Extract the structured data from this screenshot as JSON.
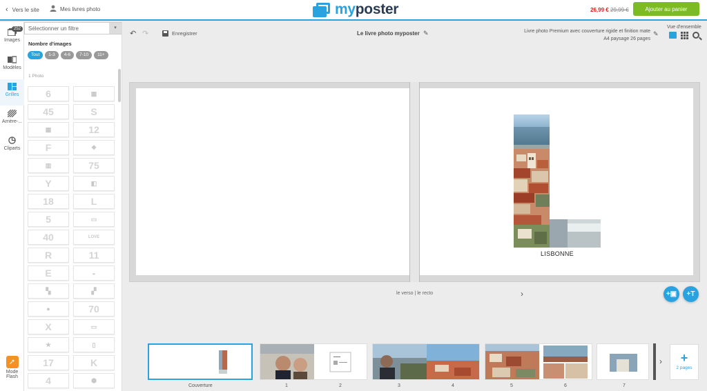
{
  "topbar": {
    "back_label": "Vers le site",
    "mybooks_label": "Mes livres photo",
    "logo_text_blue": "my",
    "logo_text_dark": "poster",
    "price_new": "26,99 €",
    "price_old": "29,99 €",
    "add_to_cart": "Ajouter au panier"
  },
  "rail": {
    "images_label": "Images",
    "images_badge": "252",
    "templates_label": "Modèles",
    "grids_label": "Grilles",
    "backgrounds_label": "Arrière-...",
    "cliparts_label": "Cliparts",
    "flash_label_1": "Mode",
    "flash_label_2": "Flash"
  },
  "panel": {
    "filter_placeholder": "Sélectionner un filtre",
    "count_title": "Nombre d'images",
    "chips": [
      "Tout",
      "1-3",
      "4-6",
      "7-10",
      "11+"
    ],
    "active_chip": "Tout",
    "section_label": "1 Photo",
    "tiles": [
      "6",
      "grid-a",
      "45",
      "S",
      "grid-b",
      "12",
      "F",
      "diamond",
      "stack",
      "75",
      "Y",
      "split",
      "18",
      "L",
      "5",
      "banner",
      "40",
      "LOVE",
      "R",
      "11",
      "E",
      "half-circle",
      "collage-a",
      "collage-b",
      "bubbles",
      "70",
      "X",
      "frame",
      "star",
      "tall",
      "17",
      "K",
      "4",
      "hexagon"
    ]
  },
  "editor": {
    "save_label": "Enregistrer",
    "book_title": "Le livre photo myposter",
    "product_line1": "Livre photo Premium avec couverture rigide et finition mate",
    "product_line2": "A4 paysage 26 pages",
    "view_label": "Vue d'ensemble"
  },
  "spread": {
    "caption": "LISBONNE",
    "nav_label": "le verso | le recto"
  },
  "thumbnails": {
    "labels": [
      "Couverture",
      "1",
      "2",
      "3",
      "4",
      "5",
      "6",
      "7"
    ],
    "add_pages_label": "2 pages"
  },
  "colors": {
    "accent": "#29a3e0",
    "cart_green": "#7cbb24",
    "price_red": "#e02020",
    "flash_orange": "#f29224"
  }
}
